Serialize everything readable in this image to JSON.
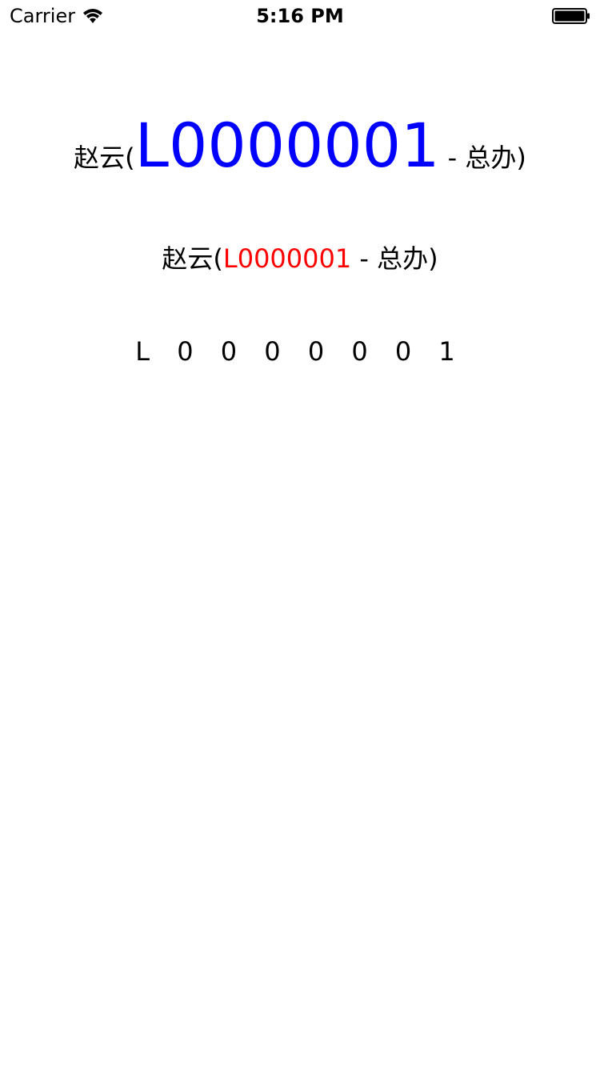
{
  "status_bar": {
    "carrier": "Carrier",
    "time": "5:16 PM"
  },
  "line1": {
    "prefix": "赵云(",
    "code": "L0000001",
    "suffix": " - 总办)",
    "code_color": "#0000ff"
  },
  "line2": {
    "prefix": "赵云(",
    "code": "L0000001",
    "suffix": " - 总办)",
    "code_color": "#ff0000"
  },
  "line3": {
    "text": "L 0 0 0 0 0 0 1"
  }
}
